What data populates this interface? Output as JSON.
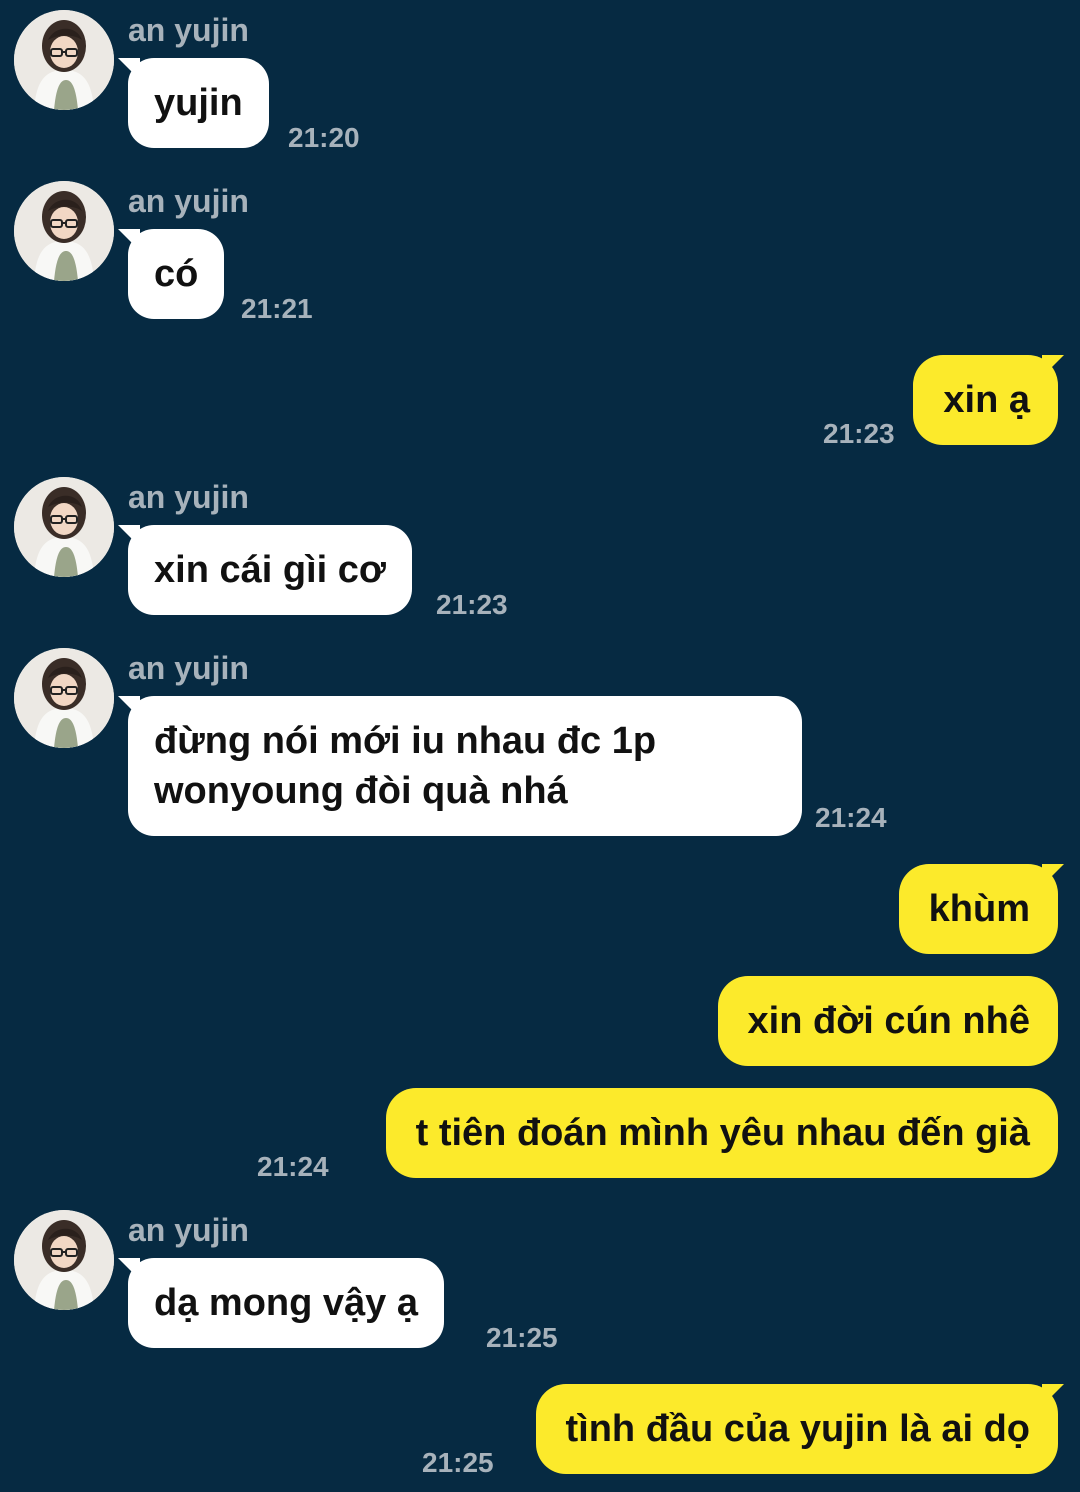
{
  "chat": {
    "contact_name": "an yujin",
    "messages": [
      {
        "sender": "an yujin",
        "text": "yujin",
        "time": "21:20"
      },
      {
        "sender": "an yujin",
        "text": "có",
        "time": "21:21"
      },
      {
        "sender": "me",
        "text": "xin ạ",
        "time": "21:23"
      },
      {
        "sender": "an yujin",
        "text": "xin cái gìi cơ",
        "time": "21:23"
      },
      {
        "sender": "an yujin",
        "line1": "đừng nói mới iu nhau đc 1p",
        "line2": "wonyoung đòi quà nhá",
        "time": "21:24"
      },
      {
        "sender": "me",
        "text": "khùm"
      },
      {
        "sender": "me",
        "text": "xin đời cún nhê"
      },
      {
        "sender": "me",
        "text": "t tiên đoán mình yêu nhau đến già",
        "time": "21:24"
      },
      {
        "sender": "an yujin",
        "text": "dạ mong vậy ạ",
        "time": "21:25"
      },
      {
        "sender": "me",
        "text": "tình đầu của yujin là ai dọ",
        "time": "21:25"
      }
    ]
  },
  "colors": {
    "background": "#062a42",
    "incoming_bubble": "#ffffff",
    "outgoing_bubble": "#fcea2b",
    "meta_text": "#a7b2bb"
  }
}
